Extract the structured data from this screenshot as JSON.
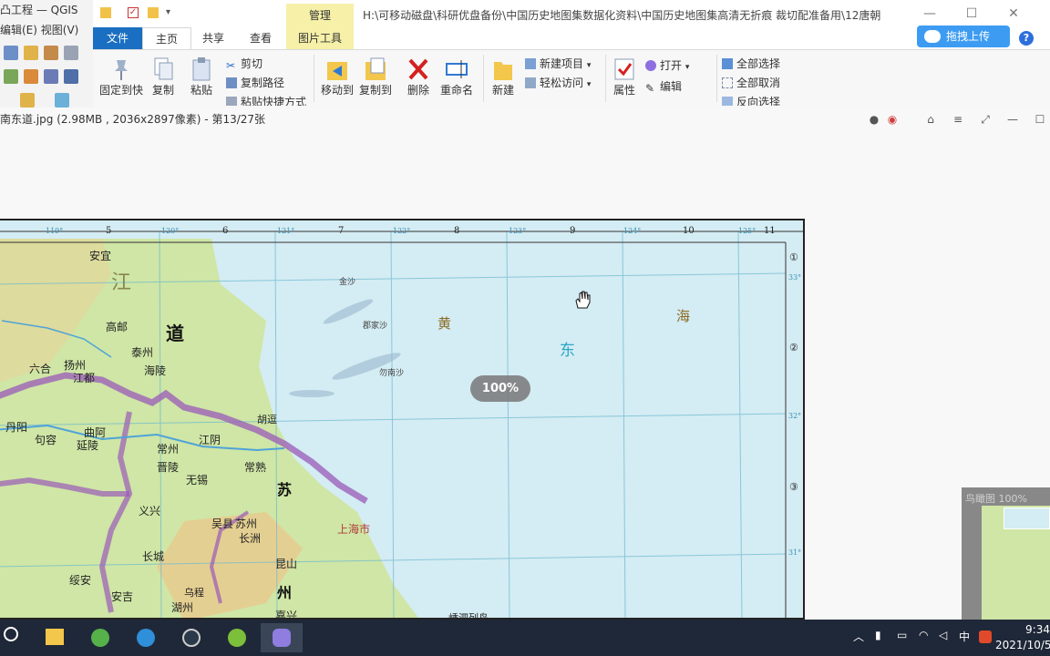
{
  "qgis": {
    "title": "凸工程 — QGIS",
    "menu": "编辑(E)  视图(V)"
  },
  "explorer": {
    "manage_tab": "管理",
    "path": "H:\\可移动磁盘\\科研优盘备份\\中国历史地图集数据化资料\\中国历史地图集高清无折痕 裁切配准备用\\12唐朝",
    "upload_label": "拖拽上传",
    "help_label": "?",
    "tabs": [
      "文件",
      "主页",
      "共享",
      "查看",
      "图片工具"
    ],
    "ribbon": {
      "pin": "固定到快",
      "copy": "复制",
      "paste": "粘贴",
      "cut": "剪切",
      "copy_path": "复制路径",
      "paste_shortcut": "粘贴快捷方式",
      "move_to": "移动到",
      "copy_to": "复制到",
      "delete": "删除",
      "rename": "重命名",
      "new_folder": "新建",
      "new_item": "新建项目",
      "easy_access": "轻松访问",
      "properties": "属性",
      "open": "打开",
      "edit": "编辑",
      "select_all": "全部选择",
      "select_none": "全部取消",
      "invert_select": "反向选择"
    }
  },
  "viewer": {
    "title": "南东道.jpg (2.98MB , 2036x2897像素) - 第13/27张",
    "zoom": "100%",
    "navigator_label": "鸟瞰图 100%"
  },
  "map": {
    "top_scale": [
      "5",
      "6",
      "7",
      "8",
      "9",
      "10",
      "11"
    ],
    "top_degrees": [
      "119°",
      "120°",
      "121°",
      "122°",
      "123°",
      "124°",
      "125°"
    ],
    "right_rows": [
      "①",
      "②",
      "③"
    ],
    "right_degrees": [
      "33°",
      "32°",
      "31°"
    ],
    "sea_labels": [
      "黄",
      "东",
      "海"
    ],
    "region_labels": [
      "江",
      "道",
      "苏",
      "州"
    ],
    "places": [
      "安宜",
      "高邮",
      "六合",
      "扬州",
      "江都",
      "海陵",
      "泰州",
      "曲阿",
      "丹阳",
      "延陵",
      "句容",
      "江阴",
      "常州",
      "晋陵",
      "无锡",
      "常熟",
      "苏州",
      "吴县",
      "长洲",
      "昆山",
      "嘉兴",
      "湖州",
      "长城",
      "义兴",
      "绥安",
      "安吉",
      "乌程",
      "上海市",
      "嵊泗列岛",
      "金沙",
      "郡家沙",
      "胡逗",
      "勿南沙"
    ]
  },
  "taskbar": {
    "time": "9:34",
    "date": "2021/10/5",
    "ime": "中"
  },
  "colors": {
    "sea": "#d4ecf3",
    "land": "#cde7a8",
    "border": "#8a4fa8",
    "accent": "#1a6fc2"
  }
}
